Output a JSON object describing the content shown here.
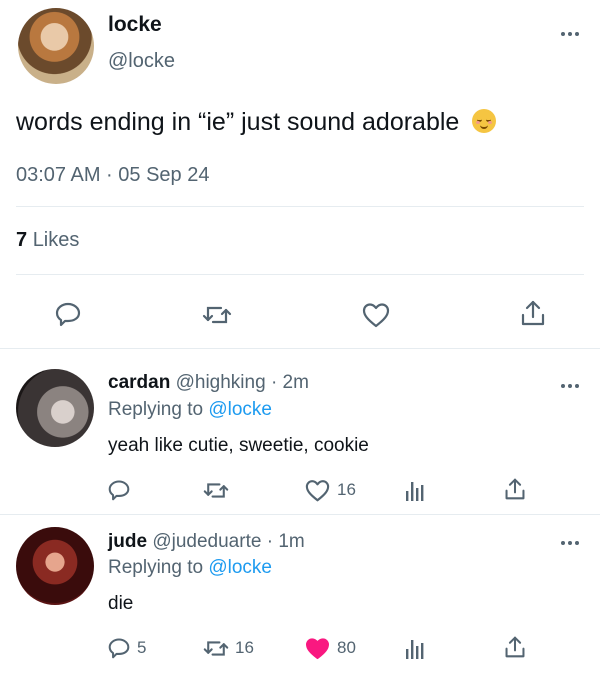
{
  "tweet": {
    "display_name": "locke",
    "handle": "@locke",
    "text": "words ending in “ie” just sound adorable",
    "emoji": "😊",
    "timestamp": "03:07 AM · 05 Sep 24",
    "likes_count": "7",
    "likes_label": "Likes"
  },
  "replies": [
    {
      "display_name": "cardan",
      "handle": "@highking",
      "time": "· 2m",
      "replying_prefix": "Replying to",
      "replying_to": "@locke",
      "text": "yeah like cutie, sweetie, cookie",
      "reply_count": "",
      "retweet_count": "",
      "like_count": "16",
      "liked": false
    },
    {
      "display_name": "jude",
      "handle": "@judeduarte",
      "time": "· 1m",
      "replying_prefix": "Replying to",
      "replying_to": "@locke",
      "text": "die",
      "reply_count": "5",
      "retweet_count": "16",
      "like_count": "80",
      "liked": true
    }
  ],
  "colors": {
    "link": "#1d9bf0",
    "like_red": "#f91880",
    "muted": "#536471"
  },
  "icons": [
    "reply-icon",
    "retweet-icon",
    "like-icon",
    "share-icon",
    "views-icon",
    "more-icon"
  ]
}
